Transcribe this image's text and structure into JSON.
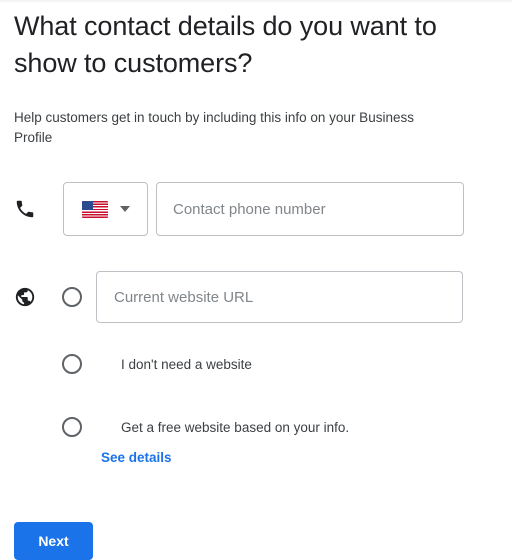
{
  "form": {
    "heading": "What contact details do you want to show to customers?",
    "description": "Help customers get in touch by including this info on your Business Profile",
    "phone": {
      "icon": "phone-icon",
      "country_flag": "us-flag-icon",
      "country_code": "US",
      "dropdown_icon": "chevron-down-icon",
      "placeholder": "Contact phone number",
      "value": ""
    },
    "website": {
      "icon": "globe-icon",
      "options": [
        {
          "id": "current-website",
          "type": "input",
          "placeholder": "Current website URL",
          "value": "",
          "selected": false
        },
        {
          "id": "no-website",
          "type": "label",
          "label": "I don't need a website",
          "selected": false
        },
        {
          "id": "free-website",
          "type": "label",
          "label": "Get a free website based on your info.",
          "selected": false,
          "link_label": "See details"
        }
      ]
    },
    "next_label": "Next"
  },
  "colors": {
    "accent": "#1a73e8",
    "text_primary": "#202124",
    "text_secondary": "#3c4043",
    "placeholder": "#80868b",
    "border": "#bdc1c6"
  }
}
